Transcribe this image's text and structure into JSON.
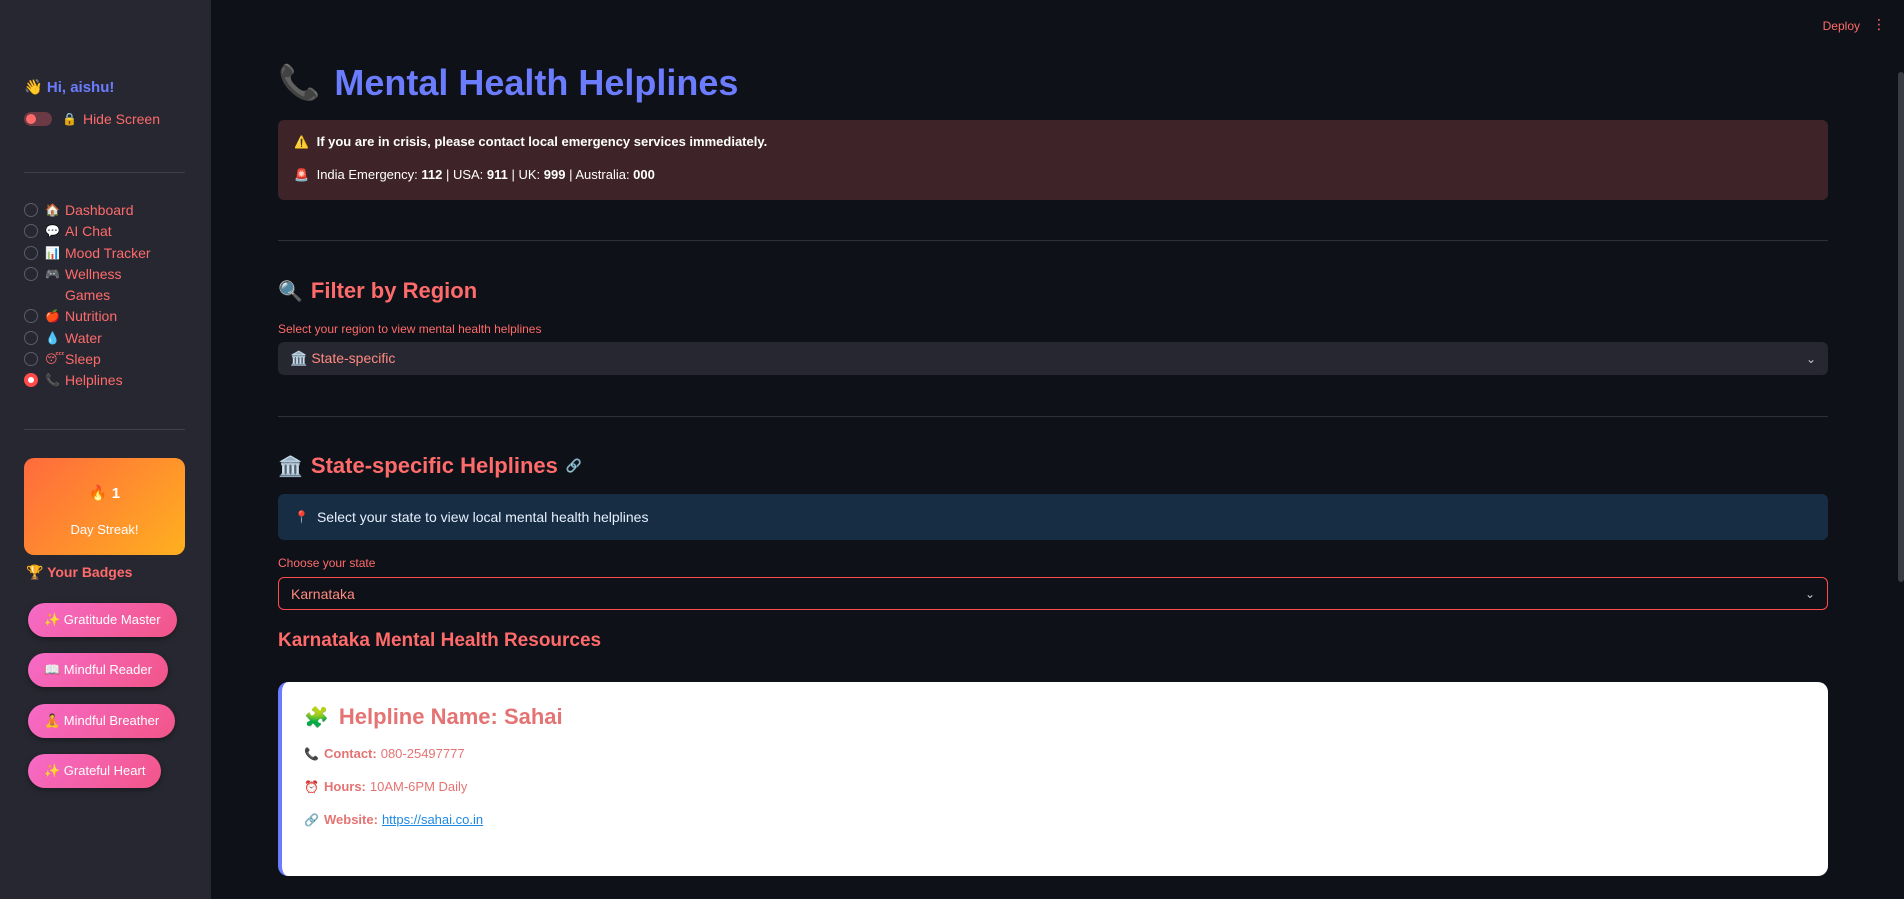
{
  "sidebar": {
    "greeting": "Hi, aishu!",
    "greeting_emoji": "👋",
    "hide_screen_label": "Hide Screen",
    "hide_screen_emoji": "🔒",
    "nav": [
      {
        "emoji": "🏠",
        "label": "Dashboard"
      },
      {
        "emoji": "💬",
        "label": "AI Chat"
      },
      {
        "emoji": "📊",
        "label": "Mood Tracker"
      },
      {
        "emoji": "🎮",
        "label": "Wellness Games"
      },
      {
        "emoji": "🍎",
        "label": "Nutrition"
      },
      {
        "emoji": "💧",
        "label": "Water"
      },
      {
        "emoji": "😴",
        "label": "Sleep"
      },
      {
        "emoji": "📞",
        "label": "Helplines"
      }
    ],
    "selected_nav": "Helplines",
    "streak": {
      "emoji": "🔥",
      "count": "1",
      "label": "Day Streak!"
    },
    "badges_title": "Your Badges",
    "badges_emoji": "🏆",
    "badges": [
      "✨ Gratitude Master",
      "📖 Mindful Reader",
      "🧘 Mindful Breather",
      "✨ Grateful Heart"
    ]
  },
  "topbar": {
    "deploy": "Deploy",
    "menu_icon": "⋮"
  },
  "page": {
    "title": "Mental Health Helplines",
    "title_icon": "📞",
    "crisis": {
      "warning_icon": "⚠️",
      "line1": "If you are in crisis, please contact local emergency services immediately.",
      "line2_icon": "🚨",
      "india_label": "India Emergency: ",
      "india_num": "112",
      "usa_label": " | USA: ",
      "usa_num": "911",
      "uk_label": " | UK: ",
      "uk_num": "999",
      "aus_label": " | Australia: ",
      "aus_num": "000"
    },
    "filter": {
      "heading": "Filter by Region",
      "heading_icon": "🔍",
      "label": "Select your region to view mental health helplines",
      "value": "🏛️ State-specific"
    },
    "state": {
      "heading": "State-specific Helplines",
      "heading_icon": "🏛️",
      "link_icon": "🔗",
      "info_icon": "📍",
      "info": "Select your state to view local mental health helplines",
      "choose_label": "Choose your state",
      "selected": "Karnataka"
    },
    "resources_title": "Karnataka Mental Health Resources",
    "card": {
      "title_icon": "🧩",
      "title": "Helpline Name: Sahai",
      "contact_icon": "📞",
      "contact_label": "Contact:",
      "contact_value": "080-25497777",
      "hours_icon": "⏰",
      "hours_label": "Hours:",
      "hours_value": "10AM-6PM Daily",
      "website_icon": "🔗",
      "website_label": "Website:",
      "website_value": "https://sahai.co.in"
    }
  },
  "colors": {
    "accent": "#ff4b4b",
    "title_blue": "#6b7cff",
    "sidebar_bg": "#262730",
    "main_bg": "#0e1117"
  }
}
